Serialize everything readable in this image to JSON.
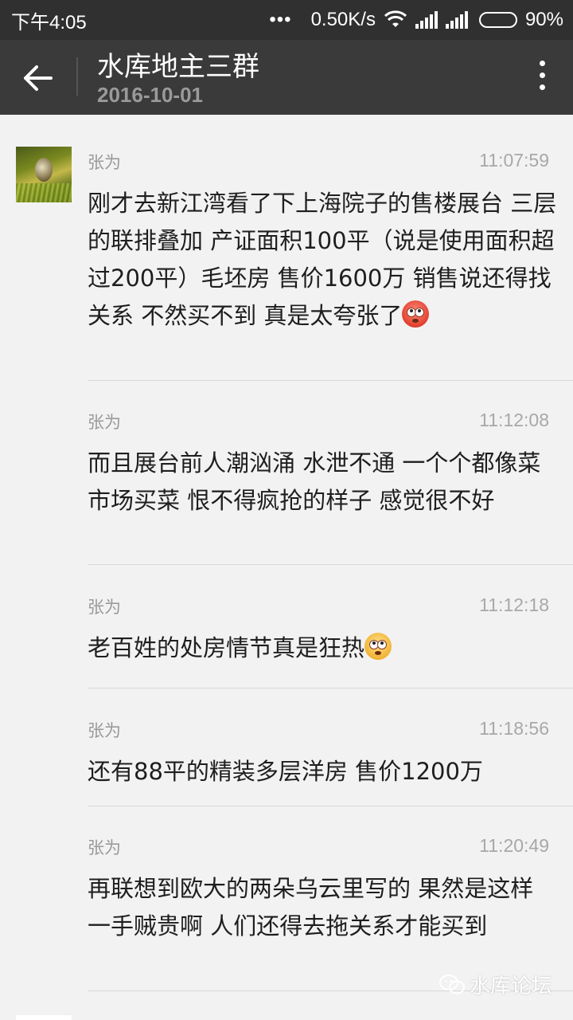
{
  "status_bar": {
    "time": "下午4:05",
    "more_dots": "•••",
    "network_speed": "0.50K/s",
    "battery": "90%",
    "battery_level": 0.9
  },
  "toolbar": {
    "title": "水库地主三群",
    "subtitle": "2016-10-01",
    "icons": [
      "back-arrow-icon",
      "more-vertical-icon"
    ]
  },
  "messages": [
    {
      "name": "张为",
      "time": "11:07:59",
      "text": "刚才去新江湾看了下上海院子的售楼展台 三层的联排叠加 产证面积100平（说是使用面积超过200平）毛坯房 售价1600万 销售说还得找关系 不然买不到 真是太夸张了",
      "emoji": "flushed-face"
    },
    {
      "name": "张为",
      "time": "11:12:08",
      "text": "而且展台前人潮汹涌 水泄不通 一个个都像菜市场买菜 恨不得疯抢的样子 感觉很不好"
    },
    {
      "name": "张为",
      "time": "11:12:18",
      "text": "老百姓的处房情节真是狂热",
      "emoji": "rolling-eyes-face"
    },
    {
      "name": "张为",
      "time": "11:18:56",
      "text": "还有88平的精装多层洋房 售价1200万"
    },
    {
      "name": "张为",
      "time": "11:20:49",
      "text": "再联想到欧大的两朵乌云里写的 果然是这样 一手贼贵啊 人们还得去拖关系才能买到"
    }
  ],
  "watermark": {
    "text": "水库论坛"
  },
  "colors": {
    "status_bar_bg": "#303030",
    "toolbar_bg": "#3a3a3a",
    "page_bg": "#f2f2f2",
    "meta_text": "#9a9a9a"
  }
}
